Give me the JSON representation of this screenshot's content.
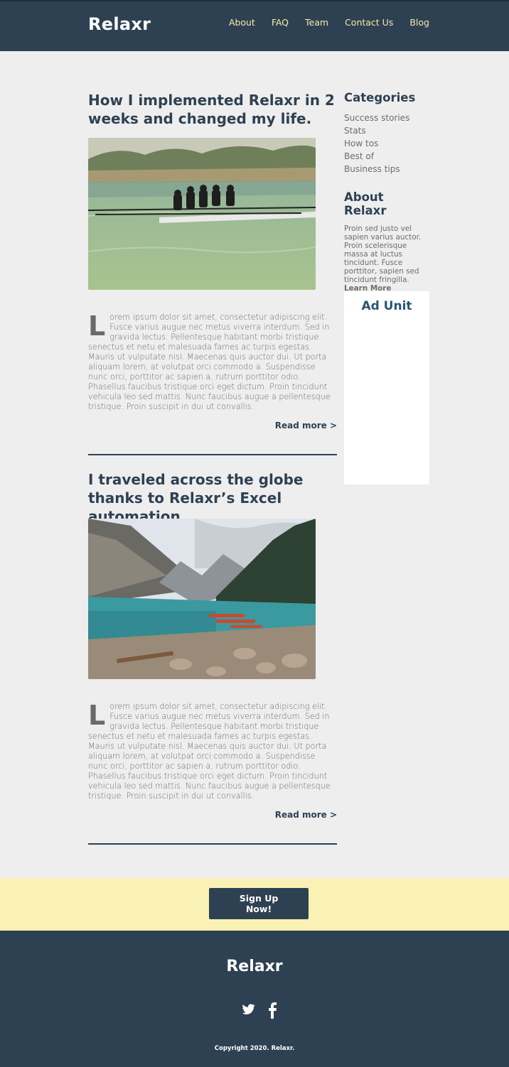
{
  "header": {
    "logo": "Relaxr",
    "nav": [
      "About",
      "FAQ",
      "Team",
      "Contact Us",
      "Blog"
    ]
  },
  "posts": [
    {
      "title": "How I implemented Relaxr in 2 weeks and changed my life.",
      "image": "rowing-team-photo",
      "dropcap": "L",
      "body": "orem ipsum dolor sit amet, consectetur adipiscing elit. Fusce varius augue nec metus viverra interdum. Sed in gravida lectus. Pellentesque habitant morbi tristique senectus et netu et malesuada fames ac turpis egestas. Mauris ut vulputate nisl. Maecenas quis auctor dui. Ut porta aliquam lorem, at volutpat orci commodo a. Suspendisse nunc orci, porttitor ac sapien a, rutrum porttitor odio. Phasellus faucibus tristique orci eget dictum. Proin tincidunt vehicula leo sed mattis. Nunc faucibus augue a pellentesque tristique. Proin suscipit in dui ut convallis.",
      "read_more": "Read more >"
    },
    {
      "title": "I traveled across the globe thanks to Relaxr’s Excel automation",
      "image": "mountain-lake-canoes-photo",
      "dropcap": "L",
      "body": "orem ipsum dolor sit amet, consectetur adipiscing elit. Fusce varius augue nec metus viverra interdum. Sed in gravida lectus. Pellentesque habitant morbi tristique senectus et netu et malesuada fames ac turpis egestas. Mauris ut vulputate nisl. Maecenas quis auctor dui. Ut porta aliquam lorem, at volutpat orci commodo a. Suspendisse nunc orci, porttitor ac sapien a, rutrum porttitor odio. Phasellus faucibus tristique orci eget dictum. Proin tincidunt vehicula leo sed mattis. Nunc faucibus augue a pellentesque tristique. Proin suscipit in dui ut convallis.",
      "read_more": "Read more >"
    }
  ],
  "sidebar": {
    "categories_title": "Categories",
    "categories": [
      "Success stories",
      "Stats",
      "How tos",
      "Best of",
      "Business tips"
    ],
    "about_title": "About Relaxr",
    "about_text": "Proin sed justo vel sapien varius auctor. Proin scelerisque massa at luctus tincidunt. Fusce porttitor, sapien sed tincidunt fringilla.",
    "learn_more": "Learn More",
    "ad_title": "Ad Unit"
  },
  "signup": {
    "line1": "Sign Up",
    "line2": "Now!"
  },
  "footer": {
    "logo": "Relaxr",
    "social_icons": [
      "twitter-icon",
      "facebook-icon"
    ],
    "copyright": "Copyright 2020. Relaxr."
  },
  "colors": {
    "navy": "#2e4152",
    "background": "#eeeeee",
    "nav_link": "#f6eaa8",
    "signup_band": "#faf2b4"
  }
}
